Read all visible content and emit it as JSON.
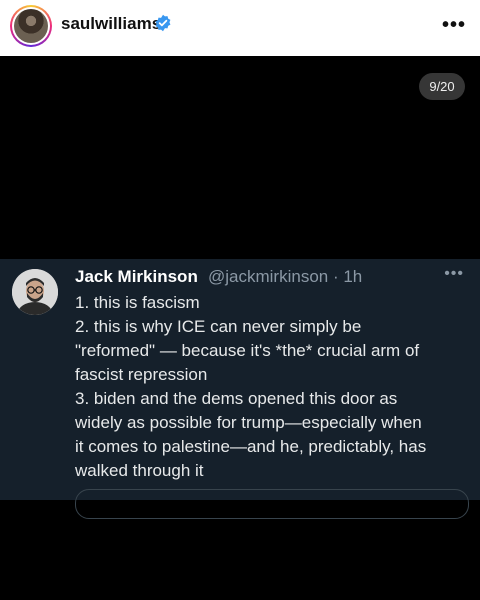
{
  "post": {
    "username": "saulwilliams",
    "media_counter": "9/20"
  },
  "tweet": {
    "name": "Jack Mirkinson",
    "handle_time": "@jackmirkinson · 1h",
    "lines": [
      "1. this is fascism",
      "2. this is why ICE can never simply be",
      "\"reformed\" — because it's *the* crucial arm of",
      "fascist repression",
      "3. biden and the dems opened this door as",
      "widely as possible for trump—especially when",
      "it comes to palestine—and he, predictably, has",
      "walked through it"
    ]
  },
  "colors": {
    "tweet_bg": "#15202b",
    "verified_blue": "#3897f0",
    "text": "#e7e9ea",
    "muted": "#8b98a5"
  },
  "icons": {
    "verified": "verified-badge-icon",
    "more": "more-horizontal-icon"
  }
}
